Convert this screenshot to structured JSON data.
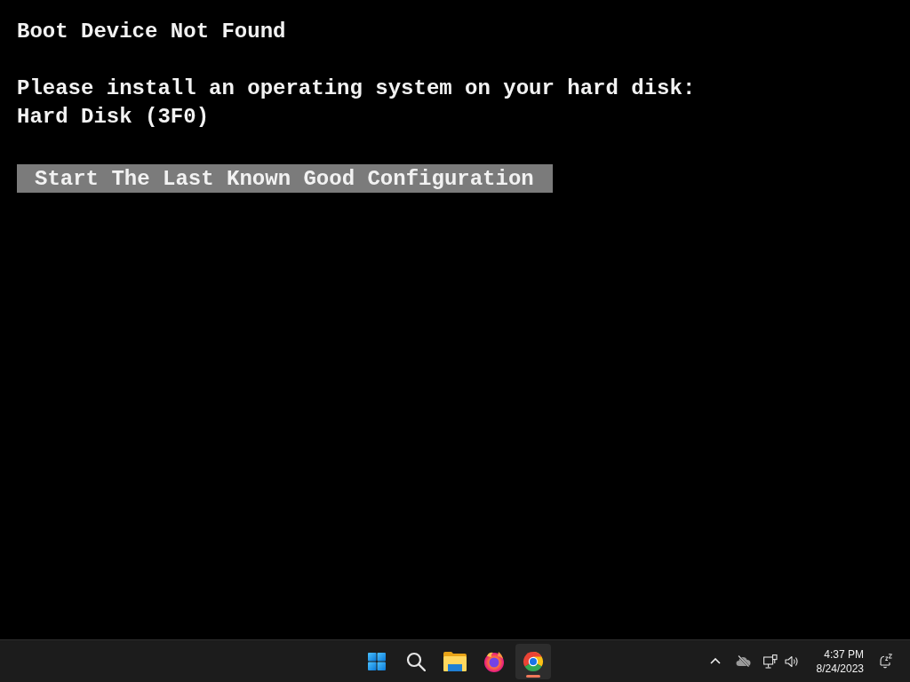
{
  "boot_screen": {
    "title": "Boot Device Not Found",
    "message": "Please install an operating system on your hard disk:",
    "device": "Hard Disk (3F0)",
    "options": [
      {
        "label": "Start The Last Known Good Configuration",
        "selected": true
      }
    ]
  },
  "taskbar": {
    "apps": [
      {
        "kind": "start",
        "active": false
      },
      {
        "kind": "search",
        "active": false
      },
      {
        "kind": "folder",
        "active": false
      },
      {
        "kind": "fox-browser",
        "active": false
      },
      {
        "kind": "round-browser",
        "active": true
      }
    ],
    "clock": {
      "time": "4:37 PM",
      "date": "8/24/2023"
    }
  }
}
